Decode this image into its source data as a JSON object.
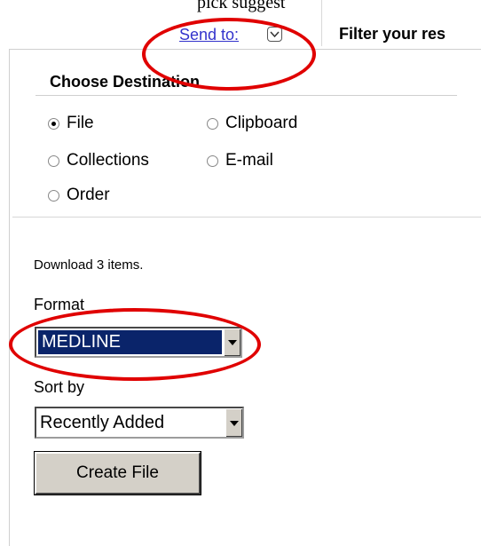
{
  "header": {
    "top_caption": "pick suggest",
    "send_to_label": "Send to:",
    "filter_label": "Filter your res"
  },
  "destination": {
    "title": "Choose Destination",
    "options": [
      {
        "label": "File",
        "checked": true
      },
      {
        "label": "Clipboard",
        "checked": false
      },
      {
        "label": "Collections",
        "checked": false
      },
      {
        "label": "E-mail",
        "checked": false
      },
      {
        "label": "Order",
        "checked": false
      }
    ]
  },
  "file_options": {
    "download_text": "Download 3 items.",
    "format_label": "Format",
    "format_value": "MEDLINE",
    "sort_label": "Sort by",
    "sort_value": "Recently Added",
    "create_button": "Create File"
  },
  "annotations": {
    "highlight_color": "#e00000"
  }
}
